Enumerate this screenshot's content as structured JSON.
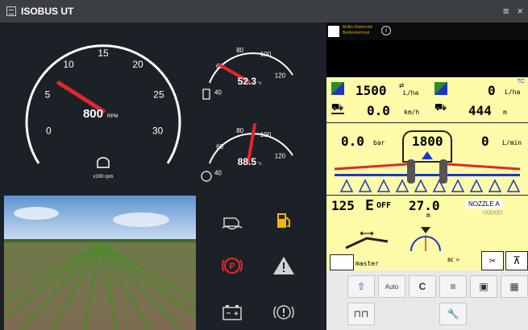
{
  "window": {
    "title": "ISOBUS UT",
    "menu_glyph": "≡",
    "close_glyph": "×"
  },
  "rpm_gauge": {
    "ticks": [
      "0",
      "5",
      "10",
      "15",
      "20",
      "25",
      "30"
    ],
    "value": "800",
    "value_unit": "RPM",
    "scale_label": "x100 rpm",
    "needle_value": 10
  },
  "temp1_gauge": {
    "ticks": [
      "40",
      "60",
      "80",
      "100",
      "120"
    ],
    "value": "52.3",
    "unit": "°c",
    "needle_value": 60
  },
  "temp2_gauge": {
    "ticks": [
      "40",
      "60",
      "80",
      "100",
      "120"
    ],
    "value": "88.5",
    "unit": "°c",
    "needle_value": 80
  },
  "vt": {
    "header_text_line1": "Müller Elektronik",
    "header_text_line2": "Bedienterminal",
    "tc_label": "TC",
    "rate_target": "1500",
    "rate_target_unit": "L/ha",
    "rate_actual": "0",
    "rate_actual_unit": "L/ha",
    "speed": "0.0",
    "speed_unit": "km/h",
    "area": "444",
    "area_unit": "m",
    "pressure": "0.0",
    "pressure_unit": "bar",
    "tank": "1800",
    "flow": "0",
    "flow_unit": "L/min",
    "section_value": "125",
    "e_label": "E",
    "e_status": "OFF",
    "height": "27.0",
    "height_unit": "m",
    "nozzle": "NOZZLE A",
    "master_label": "master",
    "sc_label": "SC"
  },
  "colors": {
    "accent_red": "#e5262b",
    "vt_yellow": "#fdfba8",
    "boom_blue": "#1d37c4"
  }
}
